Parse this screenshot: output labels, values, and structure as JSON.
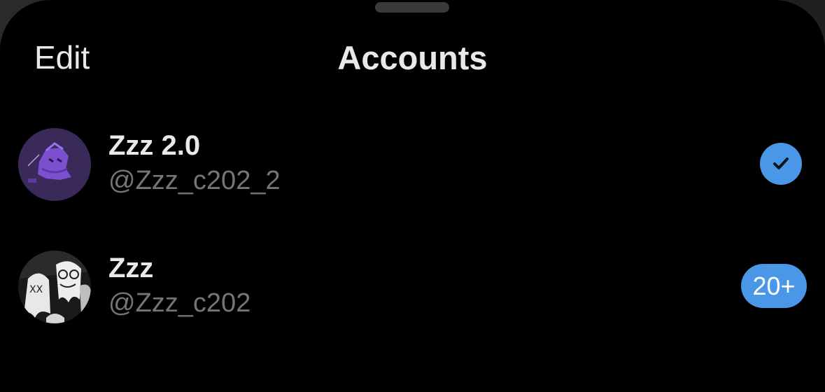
{
  "header": {
    "edit_label": "Edit",
    "title": "Accounts"
  },
  "accounts": [
    {
      "display_name": "Zzz 2.0",
      "handle": "@Zzz_c202_2",
      "avatar_icon": "purple-ghost-avatar",
      "status": "selected-check"
    },
    {
      "display_name": "Zzz",
      "handle": "@Zzz_c202",
      "avatar_icon": "ghosts-avatar",
      "notification_count": "20+"
    }
  ],
  "colors": {
    "background": "#000000",
    "accent": "#4a97e8",
    "primary_text": "#e7e9ea",
    "secondary_text": "#71767b"
  }
}
